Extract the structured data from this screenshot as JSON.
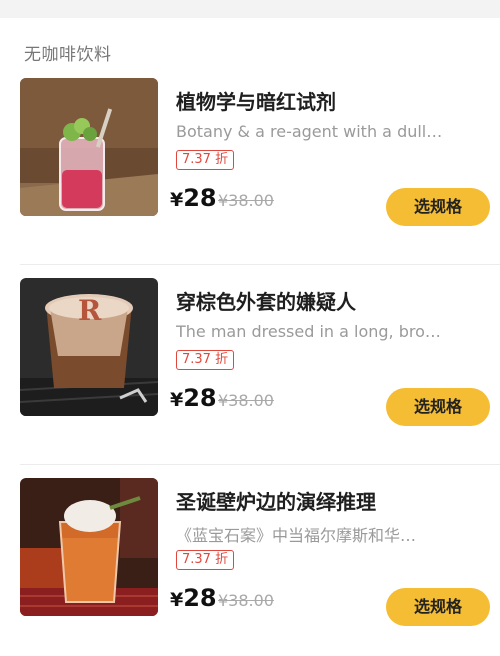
{
  "section": {
    "title": "无咖啡饮料"
  },
  "products": [
    {
      "name": "植物学与暗红试剂",
      "desc": "Botany & a re-agent with a dull…",
      "discount": "7.37 折",
      "price_symbol": "¥",
      "price": "28",
      "original_price": "¥38.00",
      "button": "选规格"
    },
    {
      "name": "穿棕色外套的嫌疑人",
      "desc": "The man dressed in a long, bro…",
      "discount": "7.37 折",
      "price_symbol": "¥",
      "price": "28",
      "original_price": "¥38.00",
      "button": "选规格"
    },
    {
      "name": "圣诞壁炉边的演绎推理",
      "desc": "《蓝宝石案》中当福尔摩斯和华…",
      "discount": "7.37 折",
      "price_symbol": "¥",
      "price": "28",
      "original_price": "¥38.00",
      "button": "选规格"
    }
  ],
  "colors": {
    "accent_button": "#f5bd33",
    "discount_red": "#e0483d"
  }
}
